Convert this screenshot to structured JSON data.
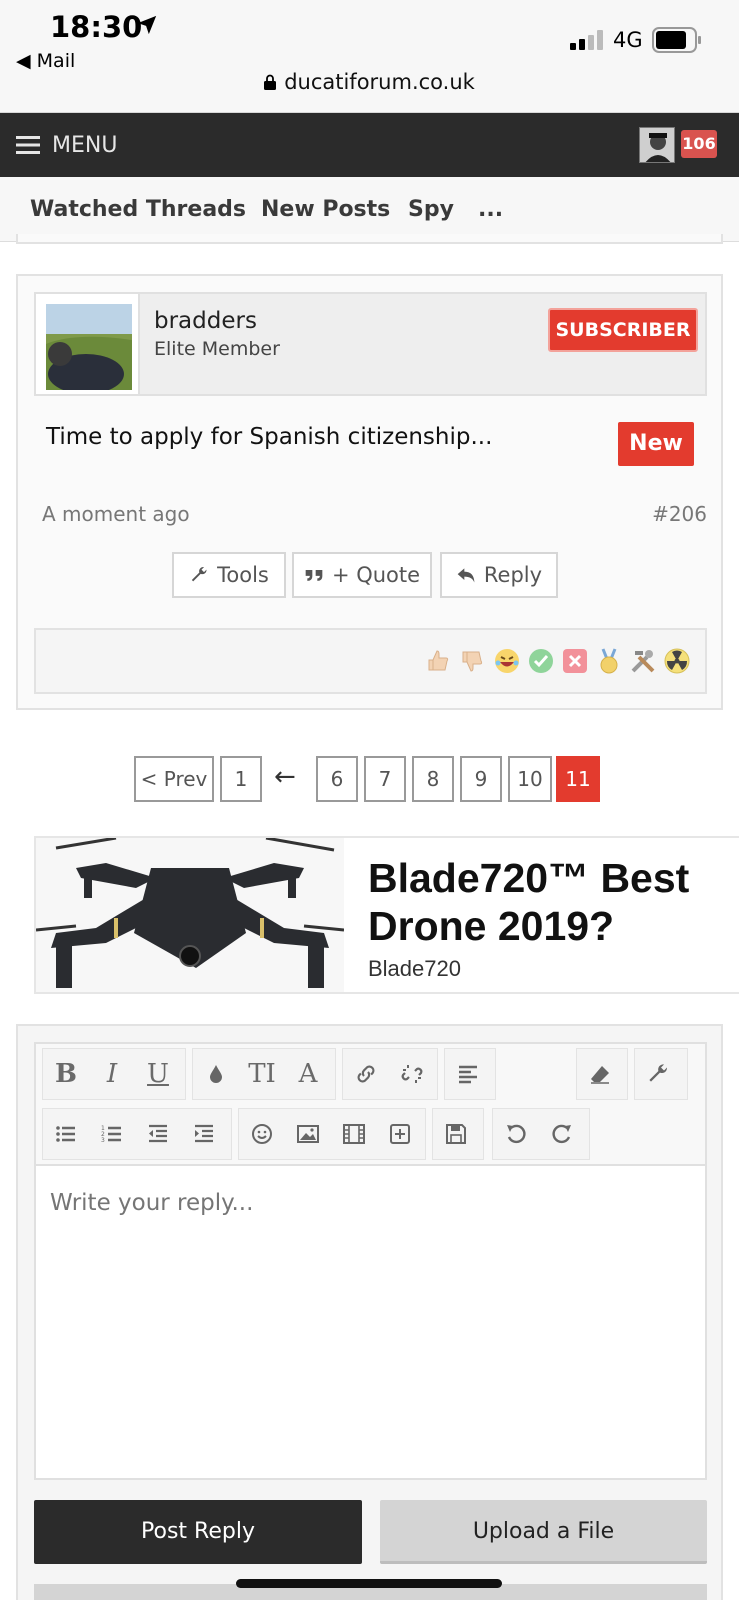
{
  "status_bar": {
    "time": "18:30",
    "back_label": "◀ Mail",
    "network": "4G",
    "url": "ducatiforum.co.uk"
  },
  "nav": {
    "menu_label": "MENU",
    "notification_count": "106"
  },
  "subnav": {
    "items": [
      "Watched Threads",
      "New Posts",
      "Spy",
      "..."
    ]
  },
  "post": {
    "username": "bradders",
    "role": "Elite Member",
    "badge": "SUBSCRIBER",
    "body": "Time to apply for Spanish citizenship...",
    "new_label": "New",
    "time": "A moment ago",
    "number": "#206",
    "buttons": {
      "tools": "Tools",
      "quote": "+ Quote",
      "reply": "Reply"
    },
    "reactions": [
      "thumbs-up",
      "thumbs-down",
      "laughing",
      "check",
      "cross",
      "medal",
      "tools",
      "radioactive"
    ]
  },
  "pagination": {
    "prev": "< Prev",
    "first": "1",
    "arrow": "←",
    "pages": [
      "6",
      "7",
      "8",
      "9",
      "10",
      "11"
    ],
    "current": "11"
  },
  "ad": {
    "title": "Blade720™ Best Drone 2019?",
    "brand": "Blade720"
  },
  "reply_editor": {
    "placeholder": "Write your reply...",
    "post_button": "Post Reply",
    "upload_button": "Upload a File",
    "toolbar_text": {
      "bold": "B",
      "italic": "I",
      "underline": "U",
      "size": "TI",
      "font": "A"
    }
  },
  "colors": {
    "accent_red": "#e33b2e",
    "nav_dark": "#2b2b2b"
  }
}
